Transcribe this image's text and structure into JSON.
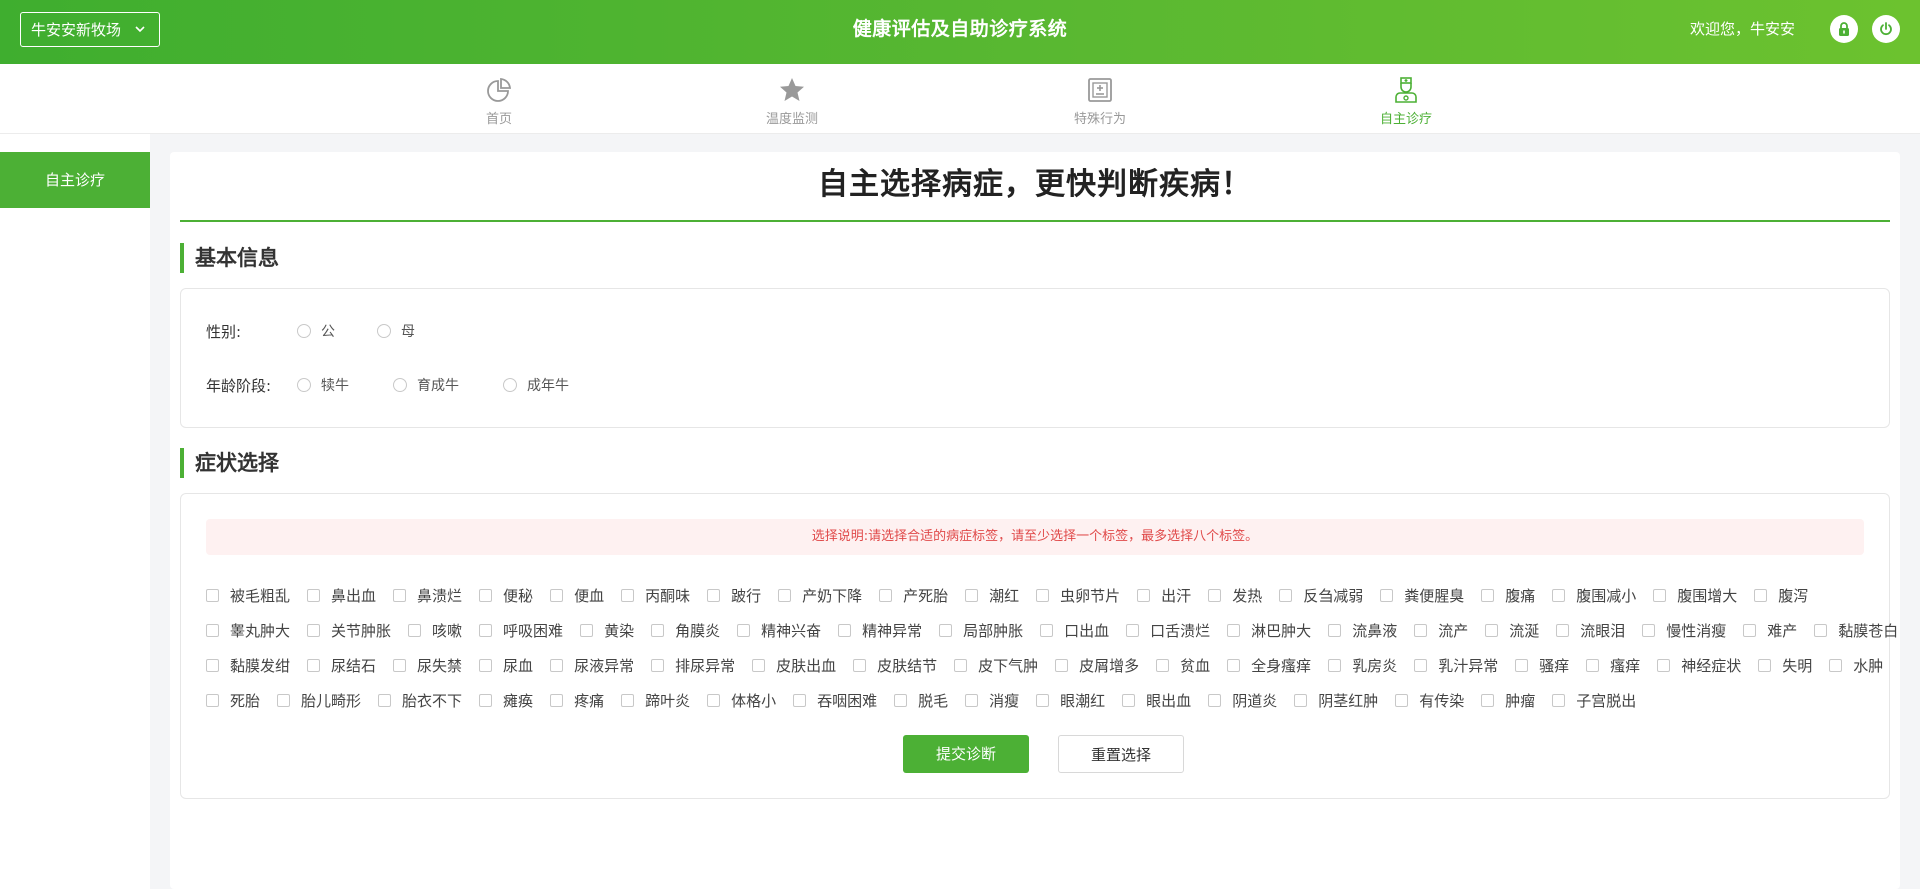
{
  "header": {
    "farm_select": "牛安安新牧场",
    "title": "健康评估及自助诊疗系统",
    "welcome": "欢迎您，牛安安"
  },
  "nav": {
    "items": [
      {
        "label": "首页",
        "icon": "pie-chart-icon"
      },
      {
        "label": "温度监测",
        "icon": "star-icon"
      },
      {
        "label": "特殊行为",
        "icon": "clipboard-plus-icon"
      },
      {
        "label": "自主诊疗",
        "icon": "doctor-icon",
        "active": true
      }
    ],
    "active_color": "#4cb035"
  },
  "sidebar": {
    "items": [
      {
        "label": "自主诊疗",
        "active": true
      }
    ]
  },
  "main": {
    "title": "自主选择病症，更快判断疾病！",
    "basic": {
      "heading": "基本信息",
      "sex_label": "性别:",
      "sex_options": [
        "公",
        "母"
      ],
      "age_label": "年龄阶段:",
      "age_options": [
        "犊牛",
        "育成牛",
        "成年牛"
      ]
    },
    "symptoms": {
      "heading": "症状选择",
      "notice": "选择说明:请选择合适的病症标签，请至少选择一个标签，最多选择八个标签。",
      "rows": [
        [
          "被毛粗乱",
          "鼻出血",
          "鼻溃烂",
          "便秘",
          "便血",
          "丙酮味",
          "跛行",
          "产奶下降",
          "产死胎",
          "潮红",
          "虫卵节片",
          "出汗",
          "发热",
          "反刍减弱",
          "粪便腥臭",
          "腹痛",
          "腹围减小",
          "腹围增大",
          "腹泻"
        ],
        [
          "睾丸肿大",
          "关节肿胀",
          "咳嗽",
          "呼吸困难",
          "黄染",
          "角膜炎",
          "精神兴奋",
          "精神异常",
          "局部肿胀",
          "口出血",
          "口舌溃烂",
          "淋巴肿大",
          "流鼻液",
          "流产",
          "流涎",
          "流眼泪",
          "慢性消瘦",
          "难产",
          "黏膜苍白"
        ],
        [
          "黏膜发绀",
          "尿结石",
          "尿失禁",
          "尿血",
          "尿液异常",
          "排尿异常",
          "皮肤出血",
          "皮肤结节",
          "皮下气肿",
          "皮屑增多",
          "贫血",
          "全身瘙痒",
          "乳房炎",
          "乳汁异常",
          "骚痒",
          "瘙痒",
          "神经症状",
          "失明",
          "水肿"
        ],
        [
          "死胎",
          "胎儿畸形",
          "胎衣不下",
          "瘫痪",
          "疼痛",
          "蹄叶炎",
          "体格小",
          "吞咽困难",
          "脱毛",
          "消瘦",
          "眼潮红",
          "眼出血",
          "阴道炎",
          "阴茎红肿",
          "有传染",
          "肿瘤",
          "子宫脱出"
        ]
      ],
      "submit_label": "提交诊断",
      "reset_label": "重置选择"
    }
  },
  "colors": {
    "brand_green": "#4cb035",
    "notice_text": "#e04a4a",
    "notice_bg": "#fef1f1"
  }
}
